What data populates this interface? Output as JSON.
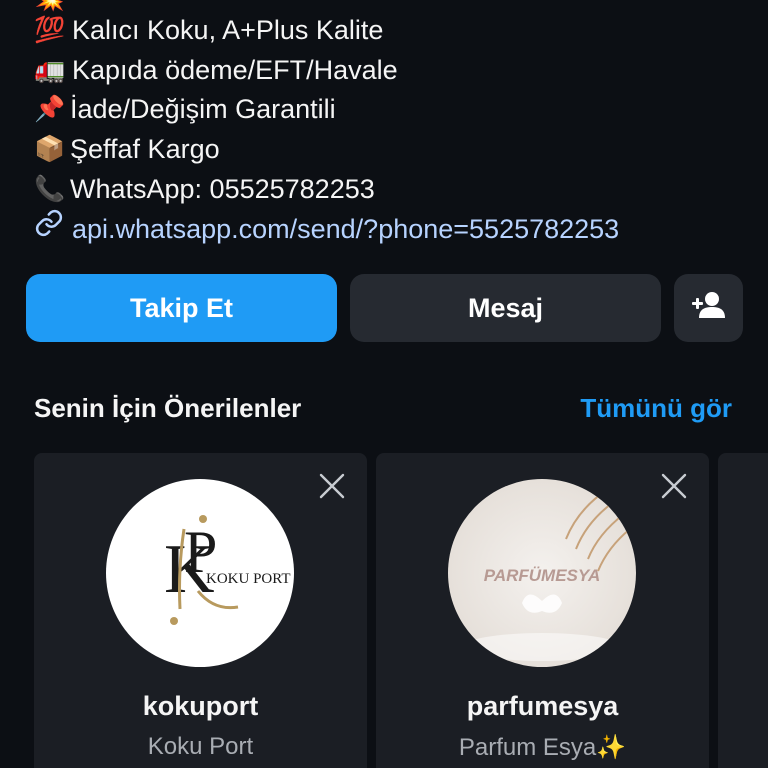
{
  "bio": {
    "lines": [
      {
        "emoji": "💯",
        "text": "Kalıcı Koku, A+Plus Kalite"
      },
      {
        "emoji": "🚛",
        "text": "Kapıda ödeme/EFT/Havale"
      },
      {
        "emoji": "📌",
        "text": "İade/Değişim Garantili"
      },
      {
        "emoji": "📦",
        "text": "Şeffaf Kargo"
      },
      {
        "emoji": "📞",
        "text": "WhatsApp: 05525782253"
      }
    ],
    "link": {
      "icon": "link-icon",
      "text": "api.whatsapp.com/send/?phone=5525782253"
    }
  },
  "actions": {
    "follow_label": "Takip Et",
    "message_label": "Mesaj",
    "add_person_icon": "add-person-icon"
  },
  "suggestions": {
    "title": "Senin İçin Önerilenler",
    "see_all_label": "Tümünü gör",
    "items": [
      {
        "username": "kokuport",
        "full_name": "Koku Port",
        "avatar_text": "KOKU PORT",
        "avatar_monogram": "KP"
      },
      {
        "username": "parfumesya",
        "full_name": "Parfum Esya✨",
        "avatar_text": "PARFÜMESYA"
      }
    ]
  },
  "colors": {
    "background": "#0c0f14",
    "primary": "#1f9bf5",
    "secondary_button": "#262a31",
    "card": "#1b1e24",
    "link": "#b7d3ff"
  }
}
